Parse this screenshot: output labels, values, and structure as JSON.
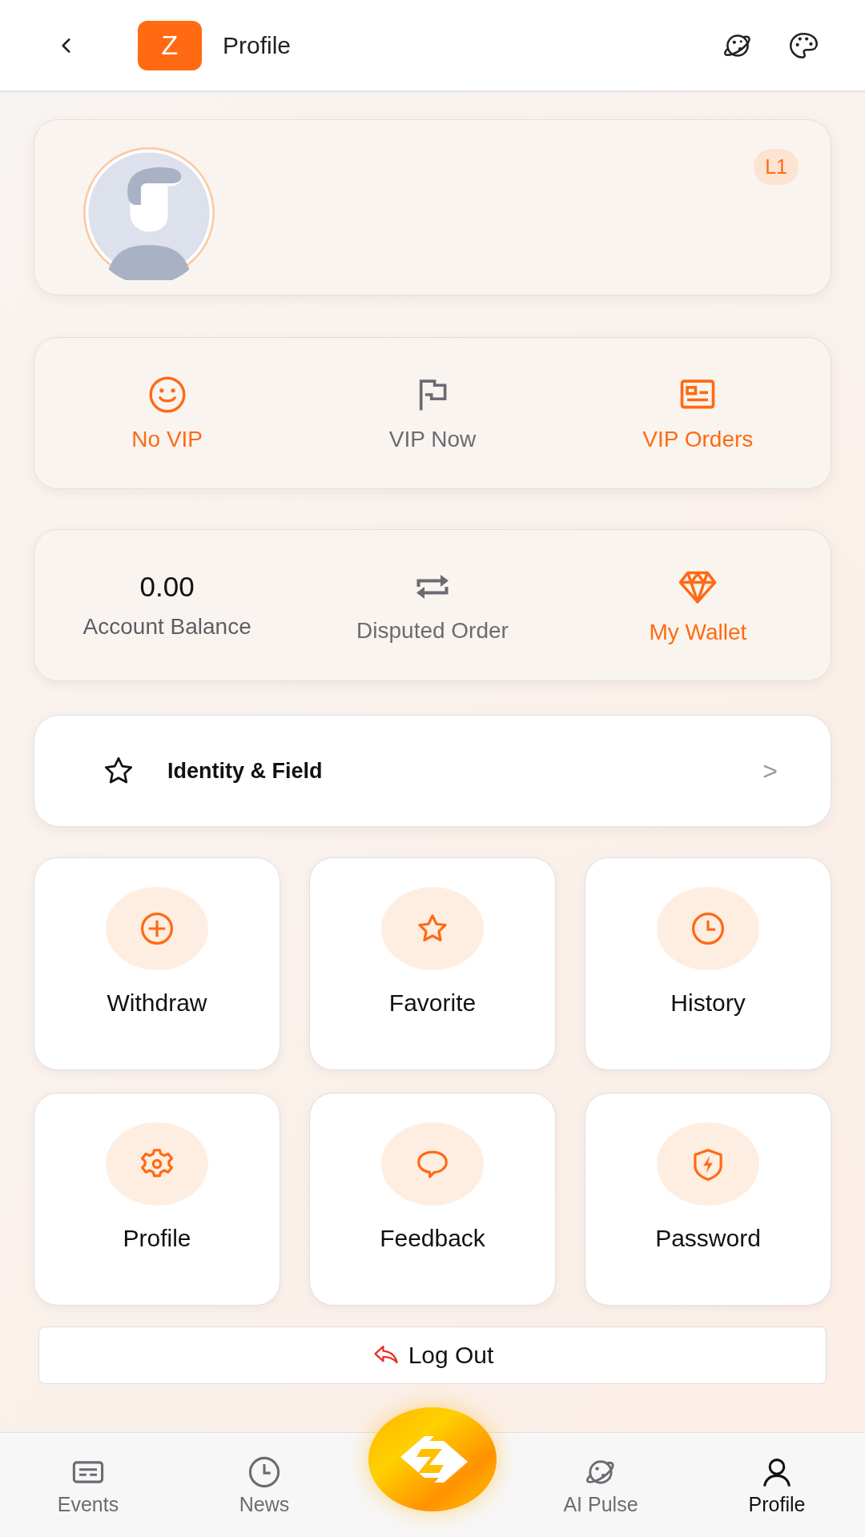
{
  "header": {
    "logo_letter": "Z",
    "title": "Profile"
  },
  "profile_card": {
    "level_badge": "L1"
  },
  "vip_items": [
    {
      "label": "No VIP",
      "color": "#ff6a13"
    },
    {
      "label": "VIP Now",
      "color": "#6b6b73"
    },
    {
      "label": "VIP Orders",
      "color": "#ff6a13"
    }
  ],
  "account": {
    "balance": "0.00",
    "balance_label": "Account Balance",
    "items": [
      {
        "label": "Disputed Order",
        "color": "#6b6b73"
      },
      {
        "label": "My Wallet",
        "color": "#ff6a13"
      }
    ]
  },
  "identity_row": {
    "label": "Identity & Field",
    "chevron": ">"
  },
  "grid_items": [
    {
      "label": "Withdraw"
    },
    {
      "label": "Favorite"
    },
    {
      "label": "History"
    },
    {
      "label": "Profile"
    },
    {
      "label": "Feedback"
    },
    {
      "label": "Password"
    }
  ],
  "logout_button": {
    "label": "Log Out"
  },
  "bottom_nav": [
    {
      "label": "Events",
      "selected": false
    },
    {
      "label": "News",
      "selected": false
    },
    {
      "label": "AI Pulse",
      "selected": false
    },
    {
      "label": "Profile",
      "selected": true
    }
  ]
}
